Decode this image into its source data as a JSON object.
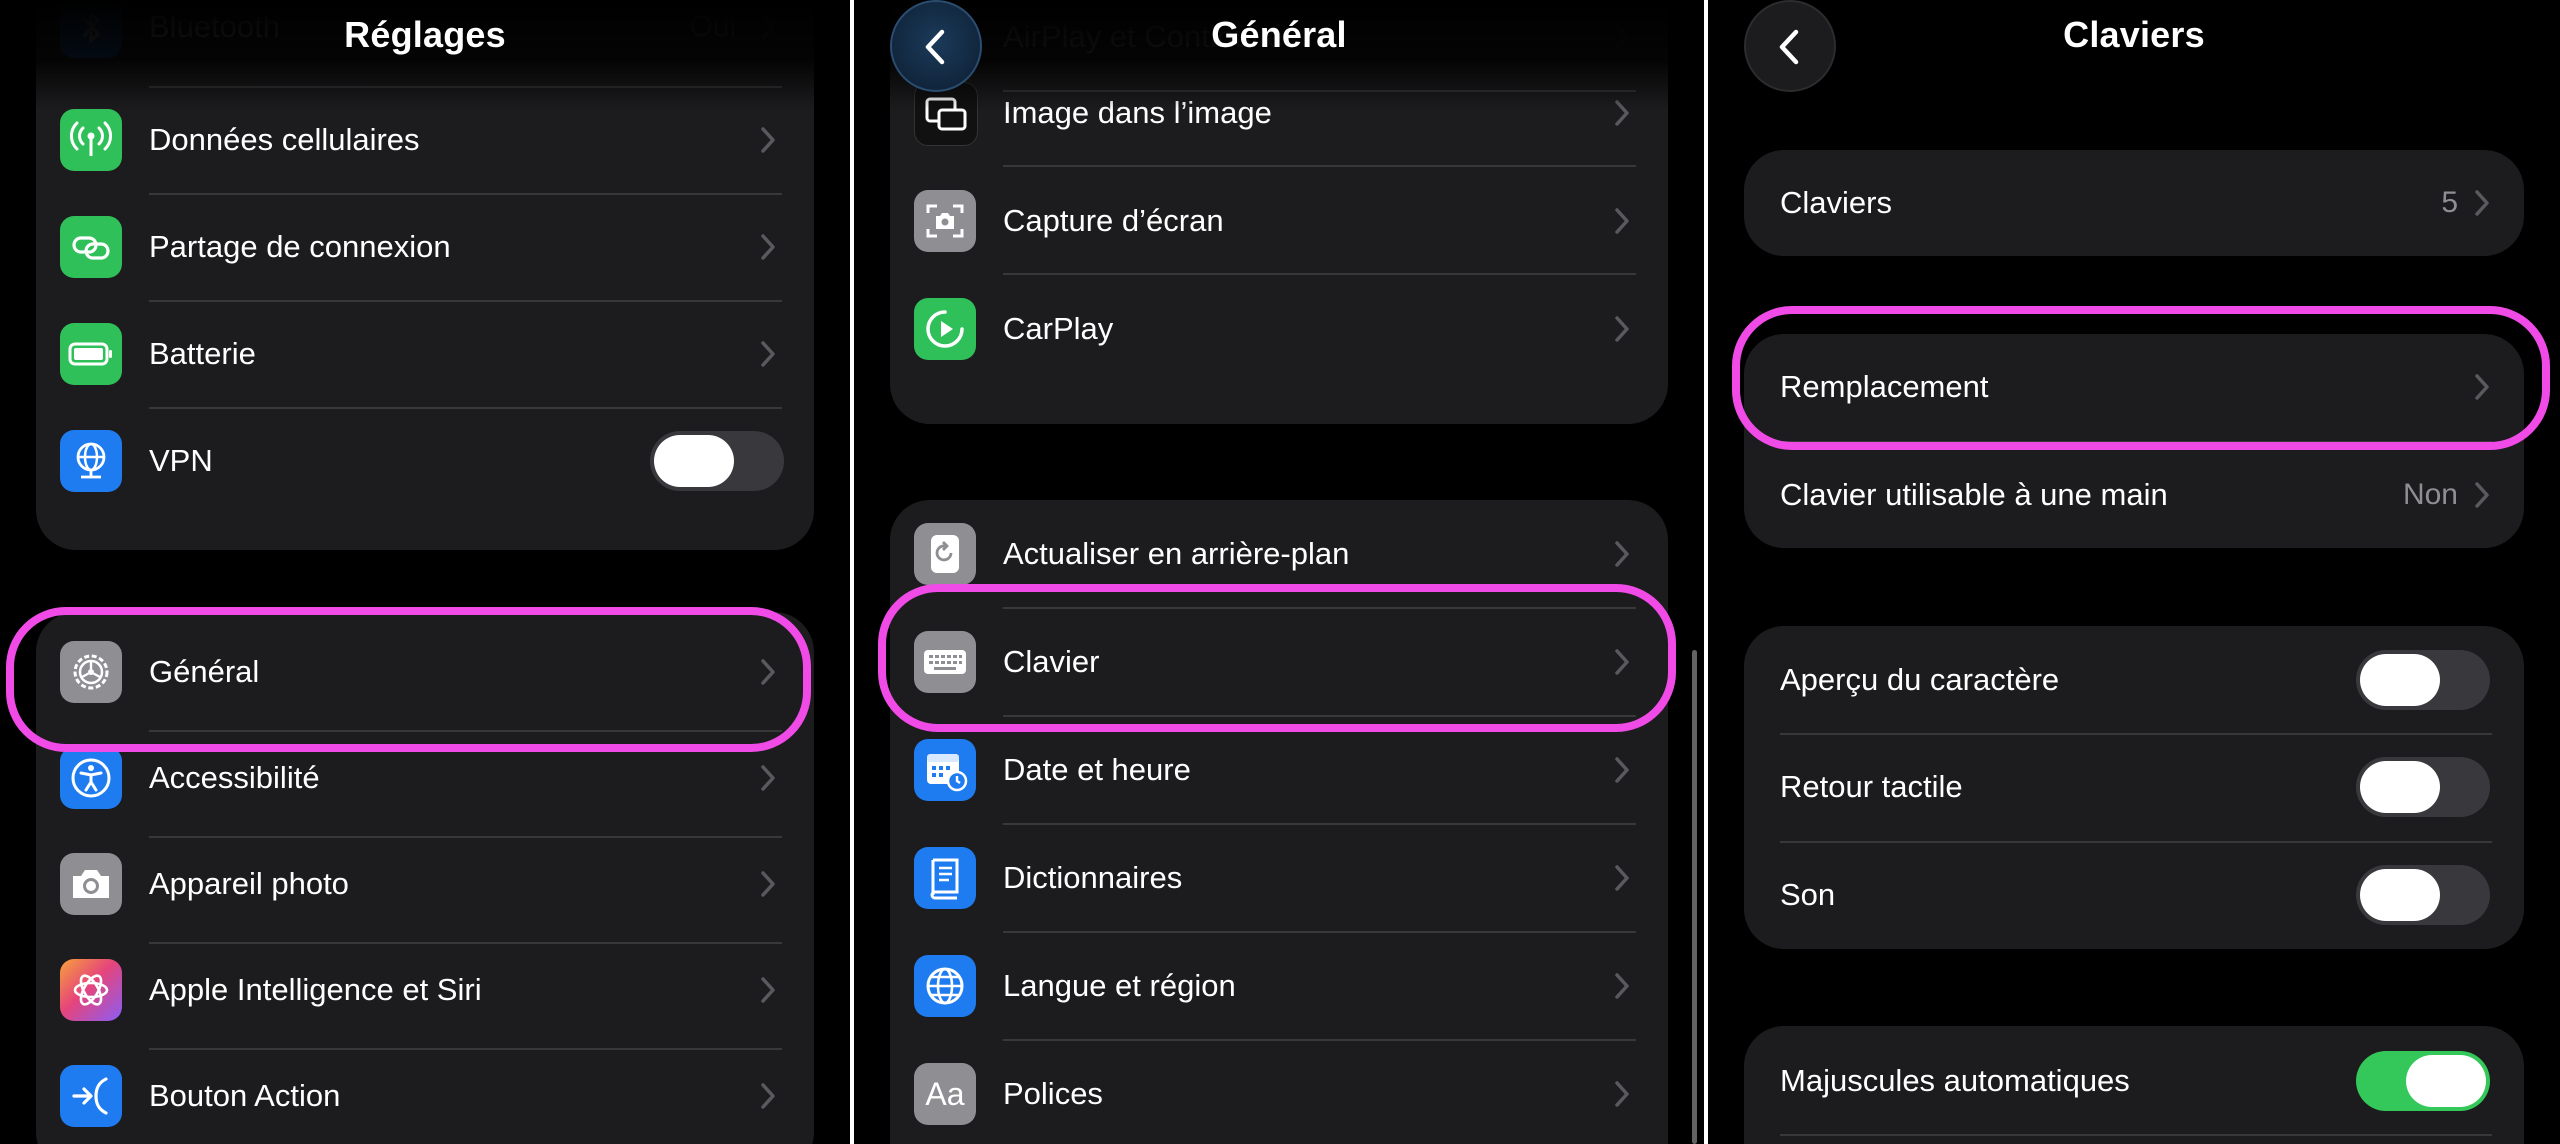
{
  "panel1": {
    "title": "Réglages",
    "partial_row": {
      "label": "Bluetooth",
      "value": "Oui"
    },
    "group1": [
      {
        "label": "Données cellulaires",
        "icon": "antenna-icon",
        "color": "#30c05a"
      },
      {
        "label": "Partage de connexion",
        "icon": "link-chain-icon",
        "color": "#30c05a"
      },
      {
        "label": "Batterie",
        "icon": "battery-icon",
        "color": "#30c05a"
      },
      {
        "label": "VPN",
        "icon": "globe-network-icon",
        "color": "#1f7cf0",
        "toggle": false
      }
    ],
    "group2": [
      {
        "label": "Général",
        "icon": "gear-icon",
        "color": "#8e8e93"
      },
      {
        "label": "Accessibilité",
        "icon": "accessibility-icon",
        "color": "#1f7cf0"
      },
      {
        "label": "Appareil photo",
        "icon": "camera-icon",
        "color": "#8e8e93"
      },
      {
        "label": "Apple Intelligence et Siri",
        "icon": "apple-intelligence-icon",
        "color": "#e15c9a"
      },
      {
        "label": "Bouton Action",
        "icon": "action-button-icon",
        "color": "#1f7cf0"
      }
    ]
  },
  "panel2": {
    "title": "Général",
    "partial_row": {
      "label": "AirPlay et Continuité"
    },
    "group1": [
      {
        "label": "Image dans l’image",
        "icon": "picture-in-picture-icon",
        "color": "#111111"
      },
      {
        "label": "Capture d’écran",
        "icon": "screenshot-icon",
        "color": "#8e8e93"
      },
      {
        "label": "CarPlay",
        "icon": "carplay-icon",
        "color": "#30c05a"
      }
    ],
    "group2": [
      {
        "label": "Actualiser en arrière-plan",
        "icon": "refresh-icon",
        "color": "#8e8e93"
      },
      {
        "label": "Clavier",
        "icon": "keyboard-icon",
        "color": "#8e8e93"
      },
      {
        "label": "Date et heure",
        "icon": "calendar-clock-icon",
        "color": "#1f7cf0"
      },
      {
        "label": "Dictionnaires",
        "icon": "book-icon",
        "color": "#1f7cf0"
      },
      {
        "label": "Langue et région",
        "icon": "globe-icon",
        "color": "#1f7cf0"
      },
      {
        "label": "Polices",
        "icon": "fonts-icon",
        "color": "#8e8e93"
      }
    ]
  },
  "panel3": {
    "title": "Claviers",
    "group1": [
      {
        "label": "Claviers",
        "value": "5"
      }
    ],
    "group2": [
      {
        "label": "Remplacement",
        "value": ""
      },
      {
        "label": "Clavier utilisable à une main",
        "value": "Non"
      }
    ],
    "group3": [
      {
        "label": "Aperçu du caractère",
        "toggle": false
      },
      {
        "label": "Retour tactile",
        "toggle": false
      },
      {
        "label": "Son",
        "toggle": false
      }
    ],
    "group4": [
      {
        "label": "Majuscules automatiques",
        "toggle": true
      }
    ]
  },
  "colors": {
    "highlight": "#f04be6",
    "switch_on": "#34c759",
    "group_bg": "#1c1c1e"
  }
}
